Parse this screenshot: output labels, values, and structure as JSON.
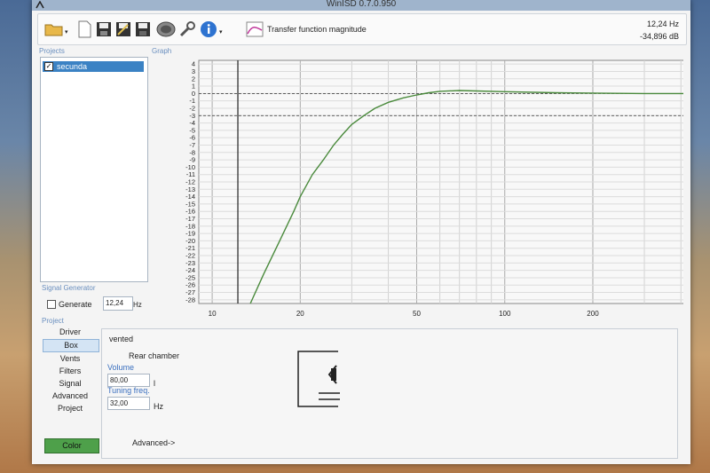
{
  "window": {
    "title": "WinISD 0.7.0.950"
  },
  "toolbar": {
    "icons": [
      "open-folder-icon",
      "new-document-icon",
      "save-icon",
      "save-as-icon",
      "save-all-icon",
      "speaker-icon",
      "wrench-icon",
      "info-icon",
      "transfer-graph-icon"
    ],
    "graph_type_label": "Transfer function magnitude",
    "readout_freq": "12,24 Hz",
    "readout_level": "-34,896 dB"
  },
  "sections": {
    "projects": "Projects",
    "graph": "Graph",
    "signal_generator": "Signal Generator",
    "project": "Project"
  },
  "projects": {
    "items": [
      {
        "label": "secunda",
        "checked": true
      }
    ]
  },
  "signal_generator": {
    "generate_label": "Generate",
    "frequency": "12,24",
    "unit": "Hz"
  },
  "nav": {
    "items": [
      "Driver",
      "Box",
      "Vents",
      "Filters",
      "Signal",
      "Advanced",
      "Project"
    ],
    "active": "Box",
    "color_button": "Color"
  },
  "box": {
    "type": "vented",
    "rear_chamber": "Rear chamber",
    "volume_label": "Volume",
    "volume_value": "80,00",
    "volume_unit": "l",
    "tuning_label": "Tuning freq.",
    "tuning_value": "32,00",
    "tuning_unit": "Hz",
    "advanced_label": "Advanced->"
  },
  "chart_data": {
    "type": "line",
    "title": "",
    "xlabel": "",
    "ylabel": "",
    "x_scale": "log",
    "xlim": [
      9,
      510
    ],
    "ylim": [
      -28.5,
      4.5
    ],
    "x_ticks": [
      10,
      20,
      50,
      100,
      200,
      500
    ],
    "y_ticks": [
      4,
      3,
      2,
      1,
      0,
      -1,
      -2,
      -3,
      -4,
      -5,
      -6,
      -7,
      -8,
      -9,
      -10,
      -11,
      -12,
      -13,
      -14,
      -15,
      -16,
      -17,
      -18,
      -19,
      -20,
      -21,
      -22,
      -23,
      -24,
      -25,
      -26,
      -27,
      -28
    ],
    "reference_lines": [
      0,
      -3
    ],
    "cursor_x": 12.24,
    "grid": true,
    "line_color": "#4a8a3c",
    "series": [
      {
        "x": [
          13.5,
          15,
          17,
          19,
          20,
          22,
          24,
          26,
          28,
          30,
          33,
          36,
          40,
          45,
          50,
          55,
          60,
          70,
          80,
          100,
          150,
          200,
          300,
          500
        ],
        "y": [
          -28.5,
          -24.5,
          -20,
          -16,
          -14,
          -11,
          -9,
          -7,
          -5.5,
          -4.2,
          -3,
          -2,
          -1.2,
          -0.6,
          -0.2,
          0.1,
          0.3,
          0.4,
          0.35,
          0.25,
          0.1,
          0.05,
          0,
          0
        ]
      }
    ]
  }
}
